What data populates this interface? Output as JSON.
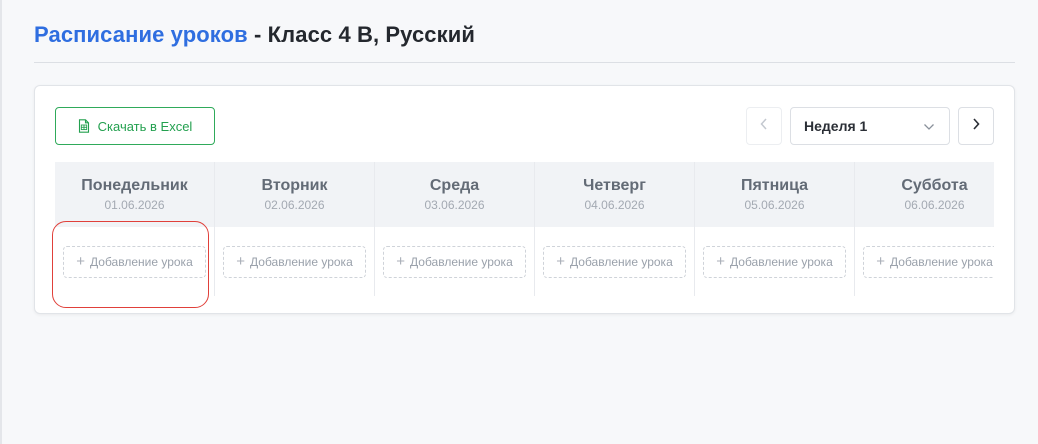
{
  "header": {
    "title_main": "Расписание уроков",
    "title_rest": " - Класс 4 В, Русский"
  },
  "toolbar": {
    "excel_label": "Скачать в Excel",
    "excel_icon": "spreadsheet-icon",
    "week_selected": "Неделя 1"
  },
  "schedule": {
    "add_label": "Добавление урока",
    "days": [
      {
        "name": "Понедельник",
        "date": "01.06.2026"
      },
      {
        "name": "Вторник",
        "date": "02.06.2026"
      },
      {
        "name": "Среда",
        "date": "03.06.2026"
      },
      {
        "name": "Четверг",
        "date": "04.06.2026"
      },
      {
        "name": "Пятница",
        "date": "05.06.2026"
      },
      {
        "name": "Суббота",
        "date": "06.06.2026"
      }
    ]
  },
  "colors": {
    "accent": "#2f6ee0",
    "excel_green": "#23a04f",
    "highlight_red": "#e0403a"
  }
}
